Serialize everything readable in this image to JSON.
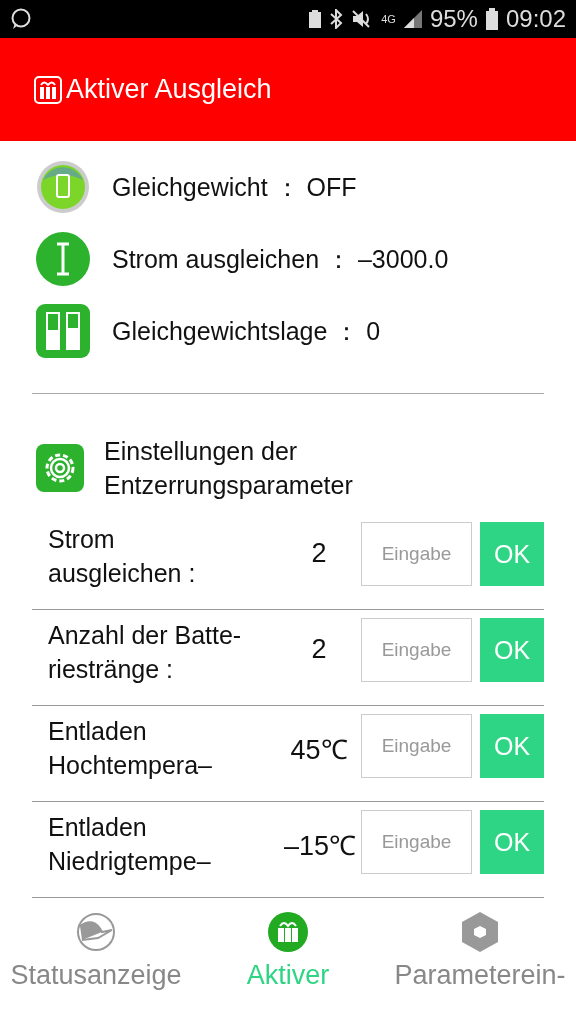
{
  "status_bar": {
    "network": "4G",
    "battery": "95%",
    "time": "09:02"
  },
  "header": {
    "title": "Aktiver Ausgleich"
  },
  "info": [
    {
      "kind": "balance",
      "text": "Gleichgewicht ： OFF"
    },
    {
      "kind": "current",
      "text": "Strom ausgleichen ： –3000.0"
    },
    {
      "kind": "position",
      "text": "Gleichgewichtslage ： 0"
    }
  ],
  "settings": {
    "title_lines": [
      "Einstellungen der",
      "Entzerrungsparameter"
    ],
    "rows": [
      {
        "label_lines": [
          "Strom",
          "ausgleichen :"
        ],
        "value": "2",
        "placeholder": "Eingabe",
        "button": "OK"
      },
      {
        "label_lines": [
          "Anzahl der Batte-",
          "riestränge :"
        ],
        "value": "2",
        "placeholder": "Eingabe",
        "button": "OK"
      },
      {
        "label_lines": [
          "Entladen",
          "Hochtempera–"
        ],
        "value": "45℃",
        "placeholder": "Eingabe",
        "button": "OK"
      },
      {
        "label_lines": [
          "Entladen",
          "Niedrigtempe–"
        ],
        "value": "–15℃",
        "placeholder": "Eingabe",
        "button": "OK"
      }
    ]
  },
  "nav": [
    {
      "kind": "status",
      "label": "Statusanzeige",
      "selected": false
    },
    {
      "kind": "active",
      "label": "Aktiver",
      "selected": true
    },
    {
      "kind": "params",
      "label": "Parameterein-",
      "selected": false
    }
  ]
}
